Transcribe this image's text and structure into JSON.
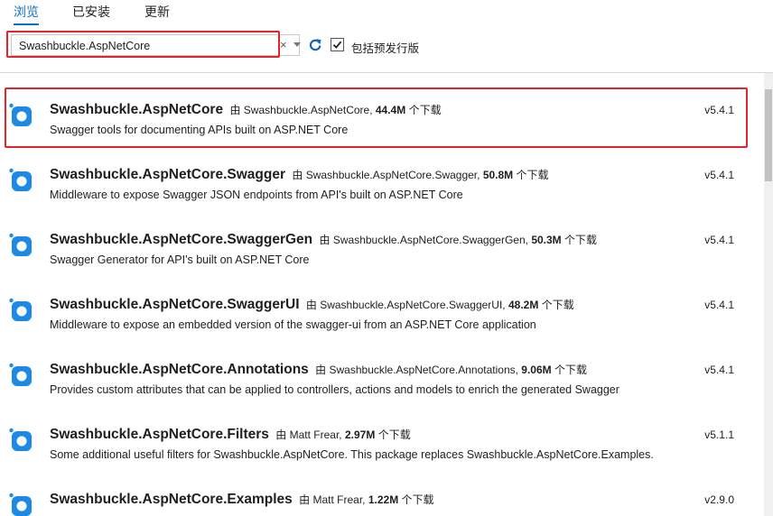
{
  "tabs": [
    {
      "label": "浏览",
      "active": true
    },
    {
      "label": "已安装",
      "active": false
    },
    {
      "label": "更新",
      "active": false
    }
  ],
  "search": {
    "value": "Swashbuckle.AspNetCore",
    "clear_glyph": "×"
  },
  "prerelease": {
    "label": "包括预发行版",
    "checked": true
  },
  "colors": {
    "accent": "#0e70c0",
    "highlight": "#e8222a",
    "icon_blue": "#1e88e5"
  },
  "by_label": "由",
  "downloads_label": "个下载",
  "packages": [
    {
      "name": "Swashbuckle.AspNetCore",
      "author": "Swashbuckle.AspNetCore,",
      "downloads": "44.4M",
      "description": "Swagger tools for documenting APIs built on ASP.NET Core",
      "version": "v5.4.1",
      "highlighted": true
    },
    {
      "name": "Swashbuckle.AspNetCore.Swagger",
      "author": "Swashbuckle.AspNetCore.Swagger,",
      "downloads": "50.8M",
      "description": "Middleware to expose Swagger JSON endpoints from API's built on ASP.NET Core",
      "version": "v5.4.1"
    },
    {
      "name": "Swashbuckle.AspNetCore.SwaggerGen",
      "author": "Swashbuckle.AspNetCore.SwaggerGen,",
      "downloads": "50.3M",
      "description": "Swagger Generator for API's built on ASP.NET Core",
      "version": "v5.4.1"
    },
    {
      "name": "Swashbuckle.AspNetCore.SwaggerUI",
      "author": "Swashbuckle.AspNetCore.SwaggerUI,",
      "downloads": "48.2M",
      "description": "Middleware to expose an embedded version of the swagger-ui from an ASP.NET Core application",
      "version": "v5.4.1"
    },
    {
      "name": "Swashbuckle.AspNetCore.Annotations",
      "author": "Swashbuckle.AspNetCore.Annotations,",
      "downloads": "9.06M",
      "description": "Provides custom attributes that can be applied to controllers, actions and models to enrich the generated Swagger",
      "version": "v5.4.1"
    },
    {
      "name": "Swashbuckle.AspNetCore.Filters",
      "author": "Matt Frear,",
      "downloads": "2.97M",
      "description": "Some additional useful filters for Swashbuckle.AspNetCore. This package replaces Swashbuckle.AspNetCore.Examples.",
      "version": "v5.1.1"
    },
    {
      "name": "Swashbuckle.AspNetCore.Examples",
      "author": "Matt Frear,",
      "downloads": "1.22M",
      "description": "",
      "version": "v2.9.0"
    }
  ]
}
